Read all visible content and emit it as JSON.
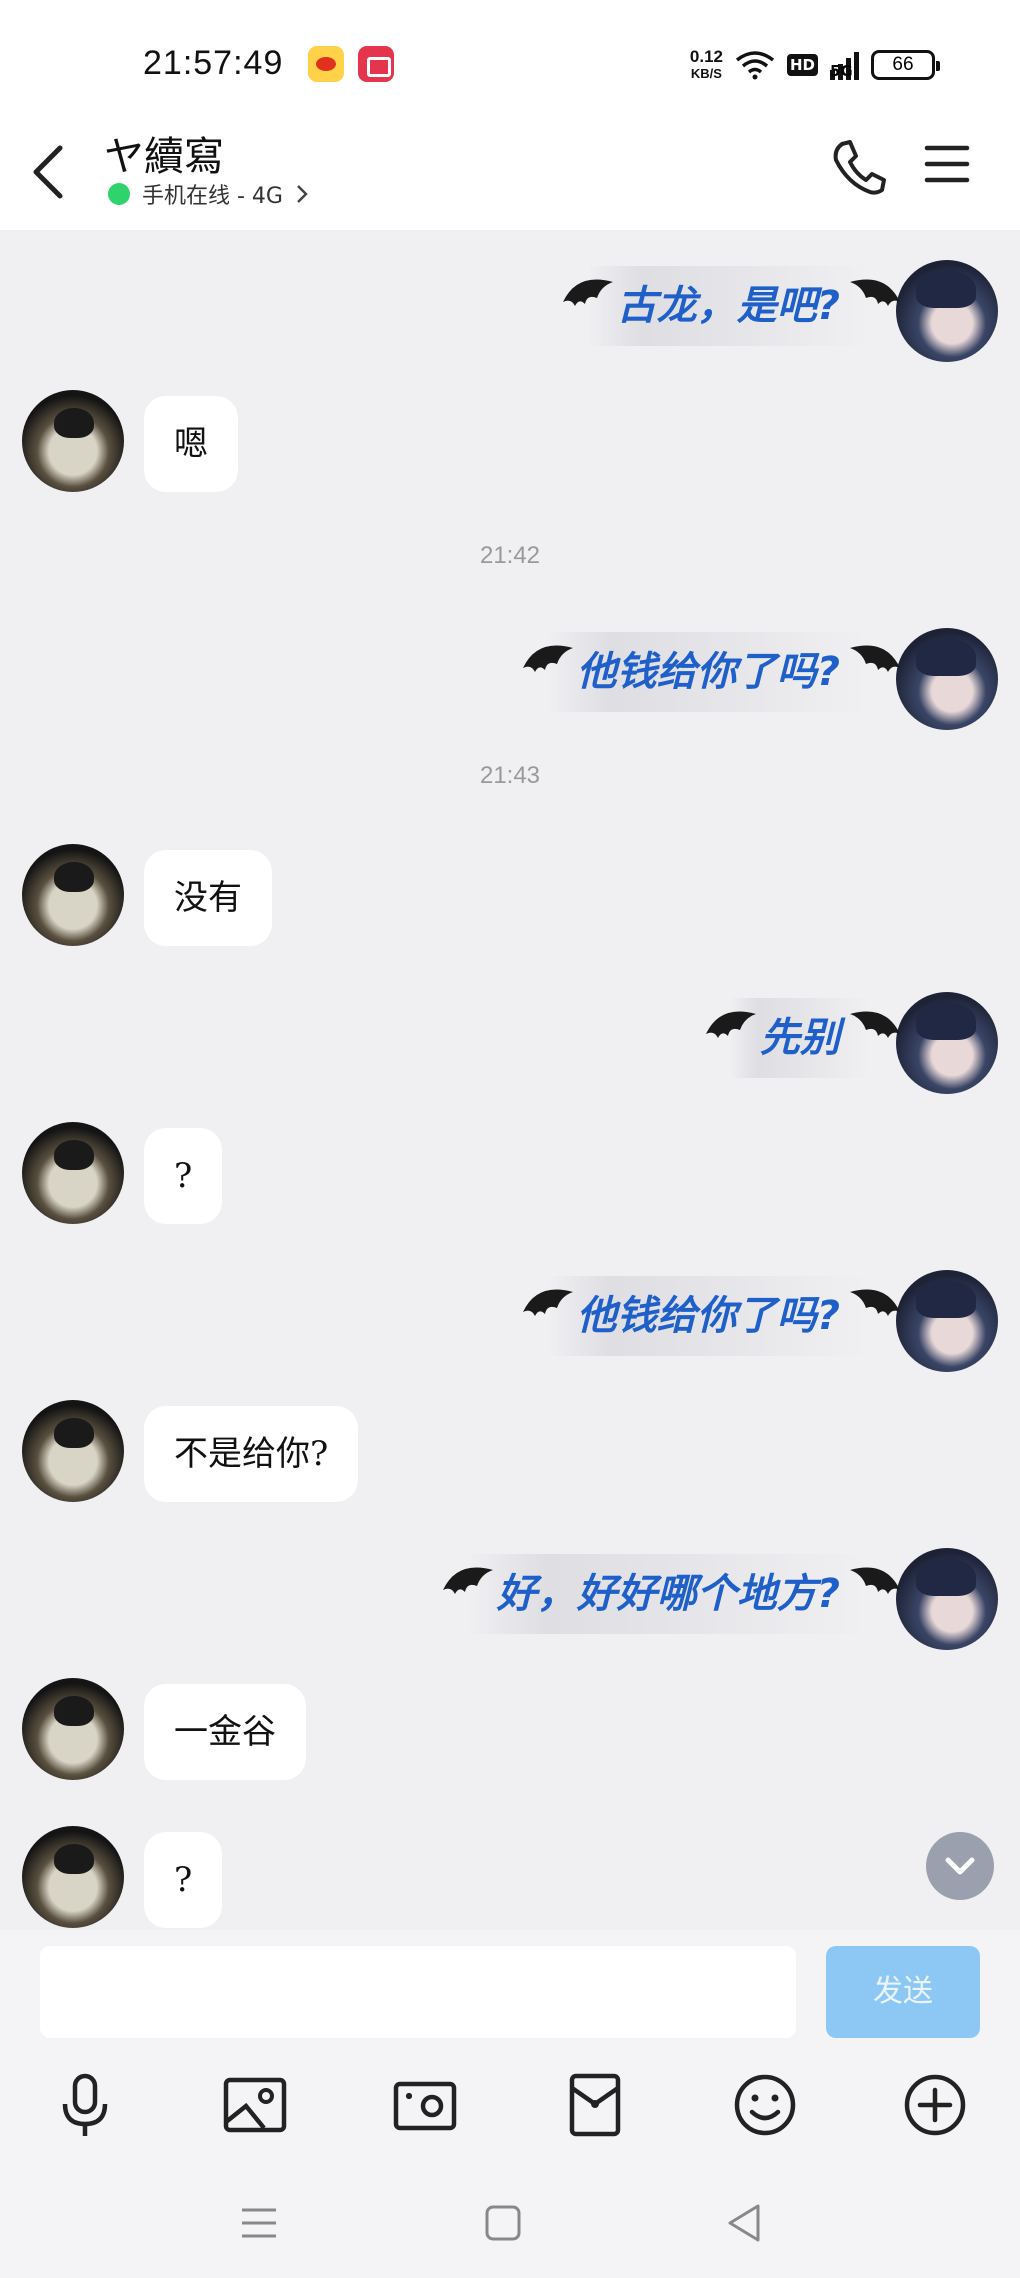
{
  "status_bar": {
    "time": "21:57:49",
    "net_speed": "0.12",
    "net_unit": "KB/S",
    "hd_label": "HD",
    "signal_label": "5G",
    "battery": "66",
    "app_icons": [
      "weibo-icon",
      "screen-record-icon"
    ]
  },
  "header": {
    "title": "ヤ續寫",
    "status": "手机在线 - 4G",
    "status_color": "#2fd36b"
  },
  "messages": {
    "m1": "古龙，是吧?",
    "m2": "嗯",
    "t1": "21:42",
    "m3": "他钱给你了吗?",
    "t2": "21:43",
    "m4": "没有",
    "m5": "先别",
    "m6": "?",
    "m7": "他钱给你了吗?",
    "m8": "不是给你?",
    "m9": "好，好好哪个地方?",
    "m10": "一金谷",
    "m11": "?"
  },
  "input": {
    "send_label": "发送",
    "send_color": "#8dc8f5"
  },
  "toolbar_icons": [
    "microphone-icon",
    "image-icon",
    "camera-icon",
    "red-packet-icon",
    "emoji-icon",
    "plus-icon"
  ],
  "accent": "#1f5fc9"
}
